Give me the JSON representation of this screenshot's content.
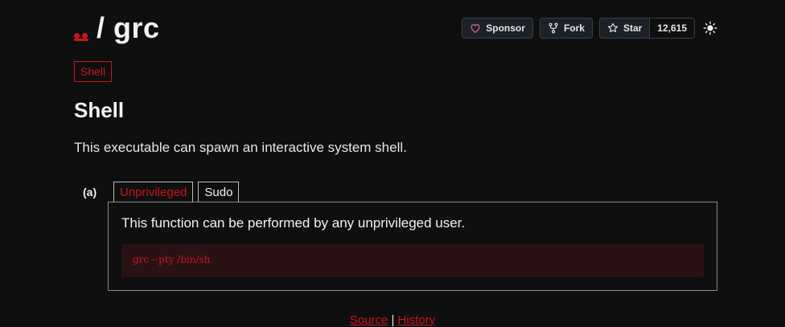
{
  "header": {
    "title": "/ grc",
    "logo": "gtfobins-logo"
  },
  "actions": {
    "sponsor_label": "Sponsor",
    "fork_label": "Fork",
    "star_label": "Star",
    "star_count": "12,615",
    "theme_icon": "sun-icon"
  },
  "tag": {
    "label": "Shell"
  },
  "section": {
    "title": "Shell",
    "description": "This executable can spawn an interactive system shell."
  },
  "example": {
    "label": "(a)",
    "tabs": [
      {
        "label": "Unprivileged",
        "active": true
      },
      {
        "label": "Sudo",
        "active": false
      }
    ],
    "text": "This function can be performed by any unprivileged user.",
    "code": "grc --pty /bin/sh"
  },
  "footer": {
    "source_label": "Source",
    "separator": "|",
    "history_label": "History"
  },
  "colors": {
    "accent": "#c8161d",
    "background": "#0f0f0f",
    "code_bg": "#2a1214"
  }
}
